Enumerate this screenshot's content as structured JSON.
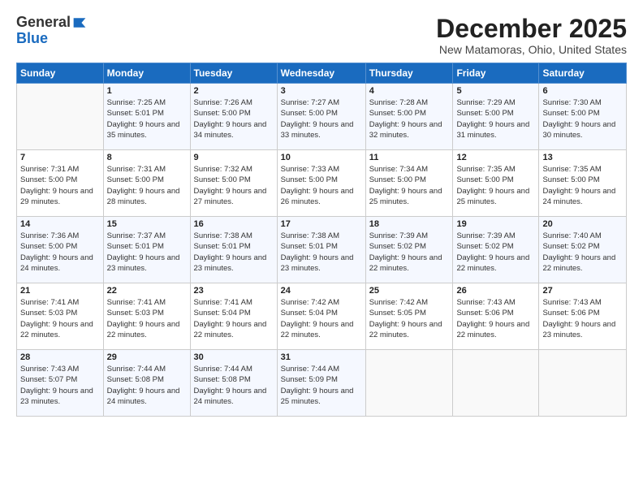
{
  "logo": {
    "general": "General",
    "blue": "Blue"
  },
  "title": "December 2025",
  "subtitle": "New Matamoras, Ohio, United States",
  "header_days": [
    "Sunday",
    "Monday",
    "Tuesday",
    "Wednesday",
    "Thursday",
    "Friday",
    "Saturday"
  ],
  "weeks": [
    [
      {
        "num": "",
        "sunrise": "",
        "sunset": "",
        "daylight": ""
      },
      {
        "num": "1",
        "sunrise": "Sunrise: 7:25 AM",
        "sunset": "Sunset: 5:01 PM",
        "daylight": "Daylight: 9 hours and 35 minutes."
      },
      {
        "num": "2",
        "sunrise": "Sunrise: 7:26 AM",
        "sunset": "Sunset: 5:00 PM",
        "daylight": "Daylight: 9 hours and 34 minutes."
      },
      {
        "num": "3",
        "sunrise": "Sunrise: 7:27 AM",
        "sunset": "Sunset: 5:00 PM",
        "daylight": "Daylight: 9 hours and 33 minutes."
      },
      {
        "num": "4",
        "sunrise": "Sunrise: 7:28 AM",
        "sunset": "Sunset: 5:00 PM",
        "daylight": "Daylight: 9 hours and 32 minutes."
      },
      {
        "num": "5",
        "sunrise": "Sunrise: 7:29 AM",
        "sunset": "Sunset: 5:00 PM",
        "daylight": "Daylight: 9 hours and 31 minutes."
      },
      {
        "num": "6",
        "sunrise": "Sunrise: 7:30 AM",
        "sunset": "Sunset: 5:00 PM",
        "daylight": "Daylight: 9 hours and 30 minutes."
      }
    ],
    [
      {
        "num": "7",
        "sunrise": "Sunrise: 7:31 AM",
        "sunset": "Sunset: 5:00 PM",
        "daylight": "Daylight: 9 hours and 29 minutes."
      },
      {
        "num": "8",
        "sunrise": "Sunrise: 7:31 AM",
        "sunset": "Sunset: 5:00 PM",
        "daylight": "Daylight: 9 hours and 28 minutes."
      },
      {
        "num": "9",
        "sunrise": "Sunrise: 7:32 AM",
        "sunset": "Sunset: 5:00 PM",
        "daylight": "Daylight: 9 hours and 27 minutes."
      },
      {
        "num": "10",
        "sunrise": "Sunrise: 7:33 AM",
        "sunset": "Sunset: 5:00 PM",
        "daylight": "Daylight: 9 hours and 26 minutes."
      },
      {
        "num": "11",
        "sunrise": "Sunrise: 7:34 AM",
        "sunset": "Sunset: 5:00 PM",
        "daylight": "Daylight: 9 hours and 25 minutes."
      },
      {
        "num": "12",
        "sunrise": "Sunrise: 7:35 AM",
        "sunset": "Sunset: 5:00 PM",
        "daylight": "Daylight: 9 hours and 25 minutes."
      },
      {
        "num": "13",
        "sunrise": "Sunrise: 7:35 AM",
        "sunset": "Sunset: 5:00 PM",
        "daylight": "Daylight: 9 hours and 24 minutes."
      }
    ],
    [
      {
        "num": "14",
        "sunrise": "Sunrise: 7:36 AM",
        "sunset": "Sunset: 5:00 PM",
        "daylight": "Daylight: 9 hours and 24 minutes."
      },
      {
        "num": "15",
        "sunrise": "Sunrise: 7:37 AM",
        "sunset": "Sunset: 5:01 PM",
        "daylight": "Daylight: 9 hours and 23 minutes."
      },
      {
        "num": "16",
        "sunrise": "Sunrise: 7:38 AM",
        "sunset": "Sunset: 5:01 PM",
        "daylight": "Daylight: 9 hours and 23 minutes."
      },
      {
        "num": "17",
        "sunrise": "Sunrise: 7:38 AM",
        "sunset": "Sunset: 5:01 PM",
        "daylight": "Daylight: 9 hours and 23 minutes."
      },
      {
        "num": "18",
        "sunrise": "Sunrise: 7:39 AM",
        "sunset": "Sunset: 5:02 PM",
        "daylight": "Daylight: 9 hours and 22 minutes."
      },
      {
        "num": "19",
        "sunrise": "Sunrise: 7:39 AM",
        "sunset": "Sunset: 5:02 PM",
        "daylight": "Daylight: 9 hours and 22 minutes."
      },
      {
        "num": "20",
        "sunrise": "Sunrise: 7:40 AM",
        "sunset": "Sunset: 5:02 PM",
        "daylight": "Daylight: 9 hours and 22 minutes."
      }
    ],
    [
      {
        "num": "21",
        "sunrise": "Sunrise: 7:41 AM",
        "sunset": "Sunset: 5:03 PM",
        "daylight": "Daylight: 9 hours and 22 minutes."
      },
      {
        "num": "22",
        "sunrise": "Sunrise: 7:41 AM",
        "sunset": "Sunset: 5:03 PM",
        "daylight": "Daylight: 9 hours and 22 minutes."
      },
      {
        "num": "23",
        "sunrise": "Sunrise: 7:41 AM",
        "sunset": "Sunset: 5:04 PM",
        "daylight": "Daylight: 9 hours and 22 minutes."
      },
      {
        "num": "24",
        "sunrise": "Sunrise: 7:42 AM",
        "sunset": "Sunset: 5:04 PM",
        "daylight": "Daylight: 9 hours and 22 minutes."
      },
      {
        "num": "25",
        "sunrise": "Sunrise: 7:42 AM",
        "sunset": "Sunset: 5:05 PM",
        "daylight": "Daylight: 9 hours and 22 minutes."
      },
      {
        "num": "26",
        "sunrise": "Sunrise: 7:43 AM",
        "sunset": "Sunset: 5:06 PM",
        "daylight": "Daylight: 9 hours and 22 minutes."
      },
      {
        "num": "27",
        "sunrise": "Sunrise: 7:43 AM",
        "sunset": "Sunset: 5:06 PM",
        "daylight": "Daylight: 9 hours and 23 minutes."
      }
    ],
    [
      {
        "num": "28",
        "sunrise": "Sunrise: 7:43 AM",
        "sunset": "Sunset: 5:07 PM",
        "daylight": "Daylight: 9 hours and 23 minutes."
      },
      {
        "num": "29",
        "sunrise": "Sunrise: 7:44 AM",
        "sunset": "Sunset: 5:08 PM",
        "daylight": "Daylight: 9 hours and 24 minutes."
      },
      {
        "num": "30",
        "sunrise": "Sunrise: 7:44 AM",
        "sunset": "Sunset: 5:08 PM",
        "daylight": "Daylight: 9 hours and 24 minutes."
      },
      {
        "num": "31",
        "sunrise": "Sunrise: 7:44 AM",
        "sunset": "Sunset: 5:09 PM",
        "daylight": "Daylight: 9 hours and 25 minutes."
      },
      {
        "num": "",
        "sunrise": "",
        "sunset": "",
        "daylight": ""
      },
      {
        "num": "",
        "sunrise": "",
        "sunset": "",
        "daylight": ""
      },
      {
        "num": "",
        "sunrise": "",
        "sunset": "",
        "daylight": ""
      }
    ]
  ]
}
